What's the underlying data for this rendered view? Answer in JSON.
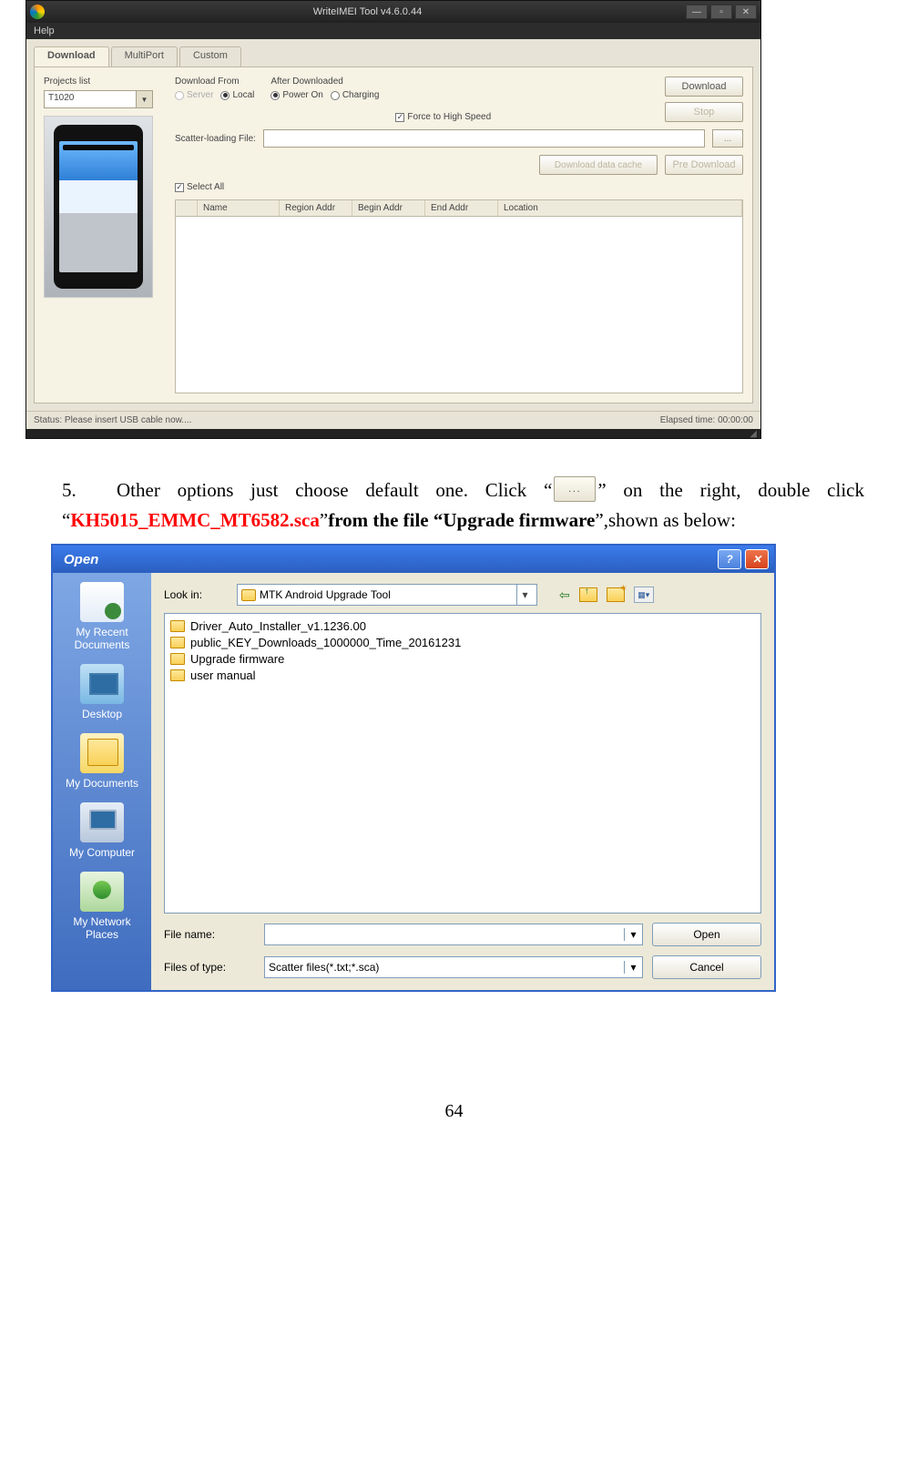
{
  "win1": {
    "title": "WriteIMEI Tool v4.6.0.44",
    "menubar": [
      "Help"
    ],
    "window_buttons": {
      "min": "—",
      "max": "▫",
      "close": "✕"
    },
    "tabs": [
      "Download",
      "MultiPort",
      "Custom"
    ],
    "projects_label": "Projects list",
    "projects_selected": "T1020",
    "download_from": {
      "label": "Download From",
      "options": [
        "Server",
        "Local"
      ],
      "selected": 1
    },
    "after_downloaded": {
      "label": "After Downloaded",
      "options": [
        "Power On",
        "Charging"
      ],
      "selected": 0
    },
    "force_high_speed": {
      "label": "Force to High Speed",
      "checked": true
    },
    "download_btn": "Download",
    "stop_btn": "Stop",
    "scatter_label": "Scatter-loading File:",
    "browse_btn": "...",
    "download_only_btn": "Download data cache",
    "predownload_btn": "Pre Download",
    "select_all": {
      "label": "Select All",
      "checked": true
    },
    "grid_headers": [
      "Name",
      "Region Addr",
      "Begin Addr",
      "End Addr",
      "Location"
    ],
    "status_left": "Status:   Please insert USB cable now....",
    "status_right": "Elapsed time:  00:00:00"
  },
  "paragraph": {
    "num": "5.",
    "t1": "Other options just choose default one. Click “",
    "inlineBtn": "...",
    "t2": "”  on the right, double click “",
    "red": "KH5015_EMMC_MT6582.sca",
    "t3": "”",
    "bold1": "from the file  “",
    "bold2": "Upgrade firmware",
    "t4": "”,shown as below:"
  },
  "win2": {
    "title": "Open",
    "look_in_label": "Look in:",
    "look_in_value": "MTK Android Upgrade Tool",
    "tool_back": "⇦",
    "tool_views": "▦▾",
    "places": [
      "My Recent Documents",
      "Desktop",
      "My Documents",
      "My Computer",
      "My Network Places"
    ],
    "files": [
      "Driver_Auto_Installer_v1.1236.00",
      "public_KEY_Downloads_1000000_Time_20161231",
      "Upgrade firmware",
      "user manual"
    ],
    "filename_label": "File name:",
    "filename_value": "",
    "filetype_label": "Files of type:",
    "filetype_value": "Scatter files(*.txt;*.sca)",
    "open_btn": "Open",
    "cancel_btn": "Cancel",
    "help_btn": "?",
    "close_btn": "✕"
  },
  "page_number": "64"
}
